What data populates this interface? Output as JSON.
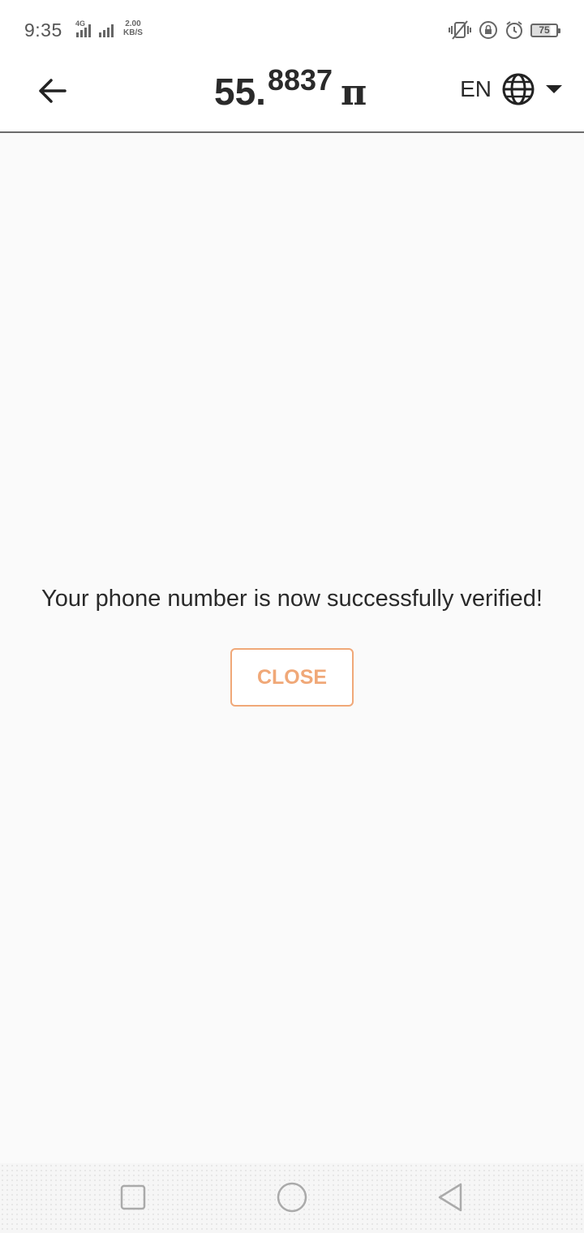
{
  "status_bar": {
    "time": "9:35",
    "network": "4G",
    "speed_value": "2.00",
    "speed_unit": "KB/S",
    "battery": "75"
  },
  "header": {
    "balance_integer": "55.",
    "balance_decimal": "8837",
    "balance_unit": "π",
    "language": "EN"
  },
  "main": {
    "message": "Your phone number is now successfully verified!",
    "close_label": "CLOSE"
  },
  "colors": {
    "accent": "#f0a878",
    "text": "#2a2a2a",
    "background": "#fafafa"
  }
}
